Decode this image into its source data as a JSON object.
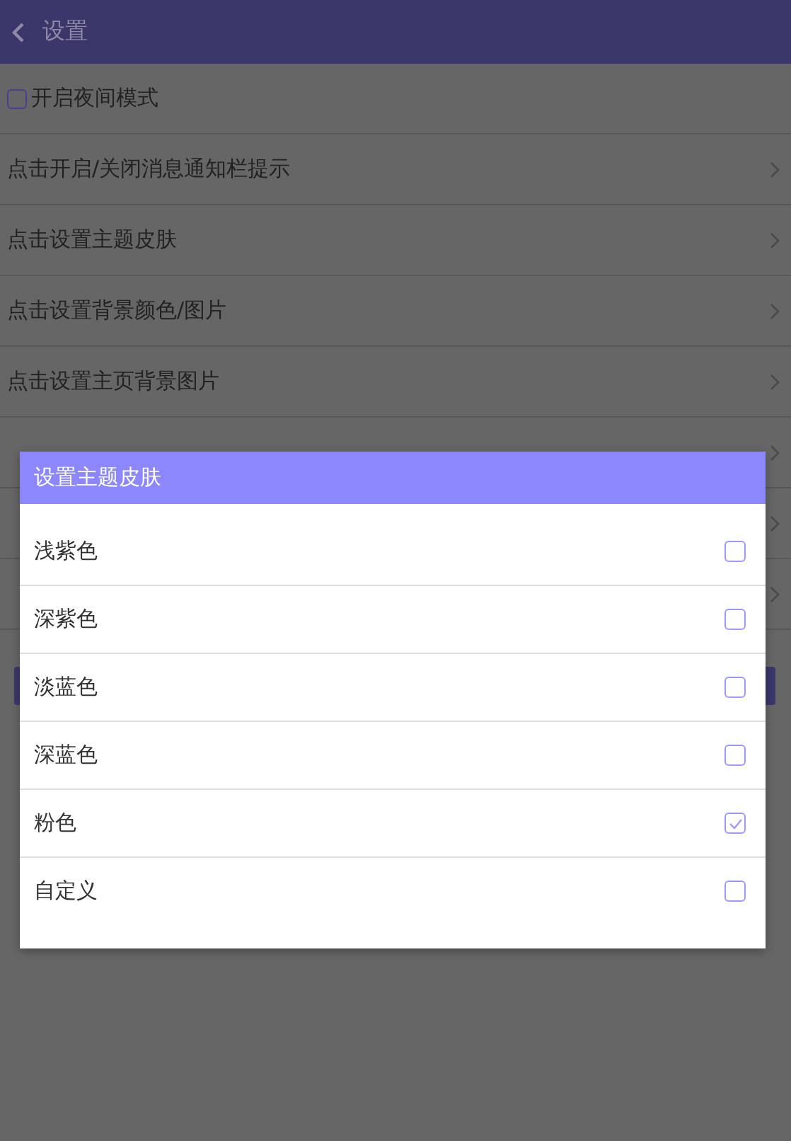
{
  "header": {
    "title": "设置"
  },
  "settings": [
    {
      "kind": "checkbox",
      "label": "开启夜间模式",
      "checked": false
    },
    {
      "kind": "link",
      "label": "点击开启/关闭消息通知栏提示"
    },
    {
      "kind": "link",
      "label": "点击设置主题皮肤"
    },
    {
      "kind": "link",
      "label": "点击设置背景颜色/图片"
    },
    {
      "kind": "link",
      "label": "点击设置主页背景图片"
    },
    {
      "kind": "link"
    },
    {
      "kind": "link"
    },
    {
      "kind": "link"
    }
  ],
  "dialog": {
    "title": "设置主题皮肤",
    "options": [
      {
        "label": "浅紫色",
        "checked": false
      },
      {
        "label": "深紫色",
        "checked": false
      },
      {
        "label": "淡蓝色",
        "checked": false
      },
      {
        "label": "深蓝色",
        "checked": false
      },
      {
        "label": "粉色",
        "checked": true
      },
      {
        "label": "自定义",
        "checked": false
      }
    ]
  }
}
